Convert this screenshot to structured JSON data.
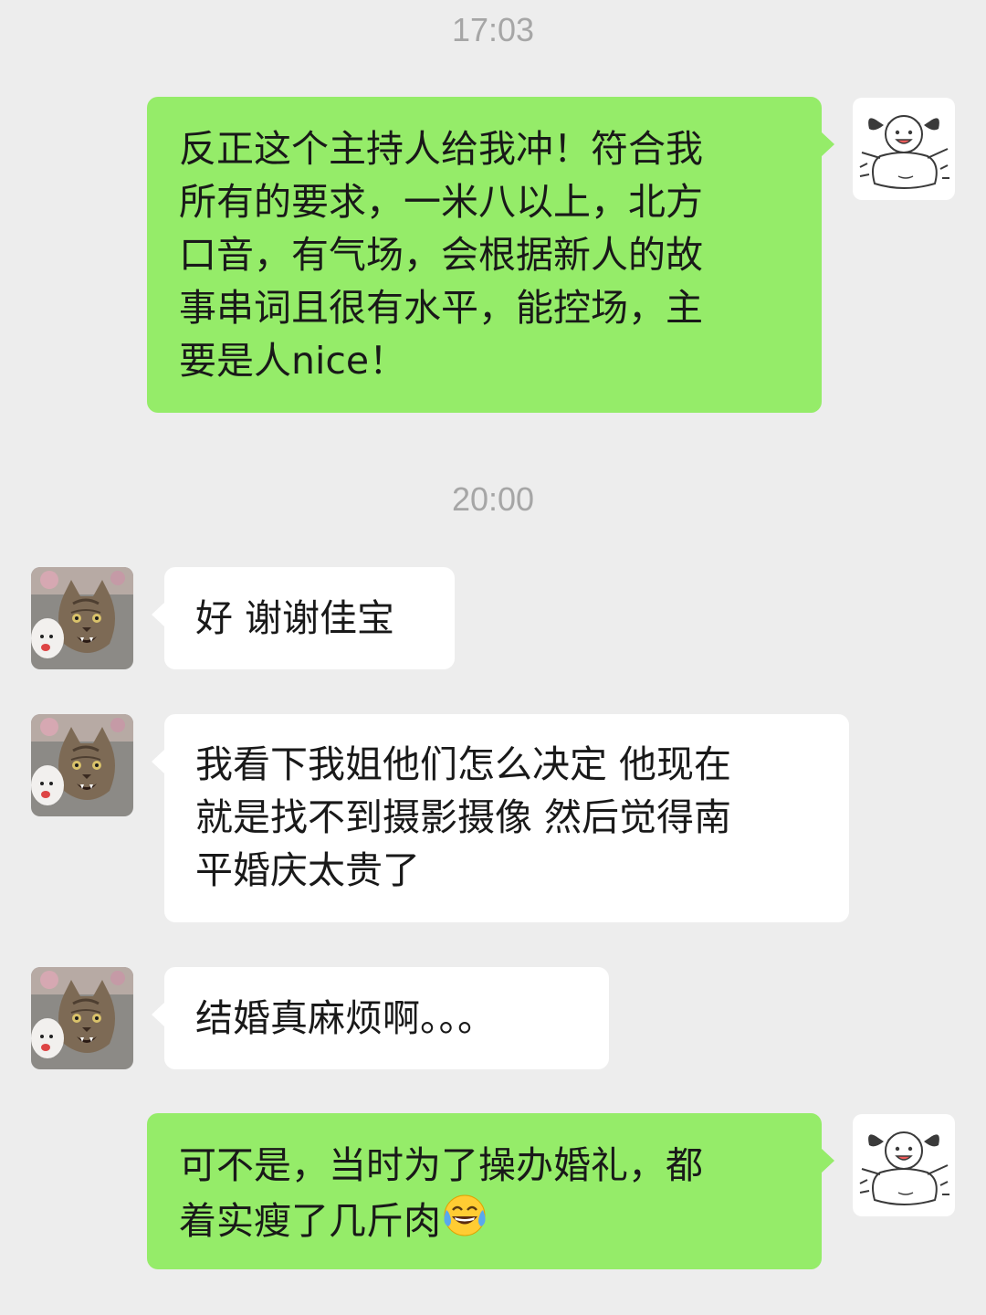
{
  "colors": {
    "background": "#ededed",
    "outgoing_bubble": "#95ec69",
    "incoming_bubble": "#ffffff",
    "timestamp_text": "#a6a6a6"
  },
  "chat": {
    "timestamps": [
      "17:03",
      "20:00"
    ],
    "messages": [
      {
        "direction": "out",
        "avatar_icon": "girl-doodle-avatar-icon",
        "lines": [
          "反正这个主持人给我冲！符合我",
          "所有的要求，一米八以上，北方",
          "口音，有气场，会根据新人的故",
          "事串词且很有水平，能控场，主",
          "要是人nice！"
        ]
      },
      {
        "direction": "in",
        "avatar_icon": "cat-photo-avatar-icon",
        "lines": [
          "好 谢谢佳宝"
        ]
      },
      {
        "direction": "in",
        "avatar_icon": "cat-photo-avatar-icon",
        "lines": [
          "我看下我姐他们怎么决定 他现在",
          "就是找不到摄影摄像 然后觉得南",
          "平婚庆太贵了"
        ]
      },
      {
        "direction": "in",
        "avatar_icon": "cat-photo-avatar-icon",
        "lines": [
          "结婚真麻烦啊。。。"
        ]
      },
      {
        "direction": "out",
        "avatar_icon": "girl-doodle-avatar-icon",
        "lines": [
          "可不是，当时为了操办婚礼，都",
          "着实瘦了几斤肉"
        ],
        "trailing_emoji": "tears-of-joy-emoji-icon"
      }
    ]
  }
}
